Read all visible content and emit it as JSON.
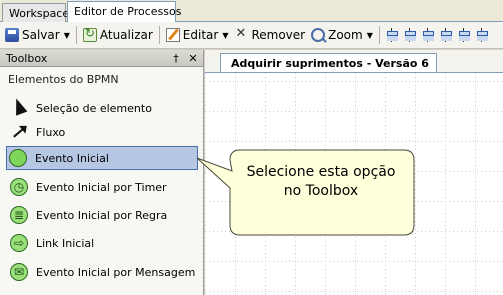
{
  "tabs": [
    "Workspace",
    "Editor de Processos"
  ],
  "toolbar": {
    "save_label": "Salvar",
    "refresh_label": "Atualizar",
    "edit_label": "Editar",
    "remove_label": "Remover",
    "zoom_label": "Zoom"
  },
  "toolbox": {
    "title": "Toolbox",
    "pin": "†",
    "close": "✕",
    "group": "Elementos do BPMN",
    "items": [
      {
        "label": "Seleção de elemento",
        "icon": "pointer-icon"
      },
      {
        "label": "Fluxo",
        "icon": "flow-arrow-icon"
      },
      {
        "label": "Evento Inicial",
        "icon": "start-event-icon",
        "selected": true
      },
      {
        "label": "Evento Inicial por Timer",
        "icon": "timer-start-event-icon"
      },
      {
        "label": "Evento Inicial por Regra",
        "icon": "rule-start-event-icon"
      },
      {
        "label": "Link Inicial",
        "icon": "link-start-icon"
      },
      {
        "label": "Evento Inicial por Mensagem",
        "icon": "message-start-event-icon"
      }
    ]
  },
  "editor": {
    "doc_tab": "Adquirir suprimentos - Versão 6"
  },
  "callout": {
    "line1": "Selecione esta opção",
    "line2": "no Toolbox"
  },
  "colors": {
    "selection_bg": "#b6c7e4",
    "selection_border": "#4a6ea8",
    "callout_fill": "#ffffdc",
    "start_event_fill": "#9be07a"
  }
}
